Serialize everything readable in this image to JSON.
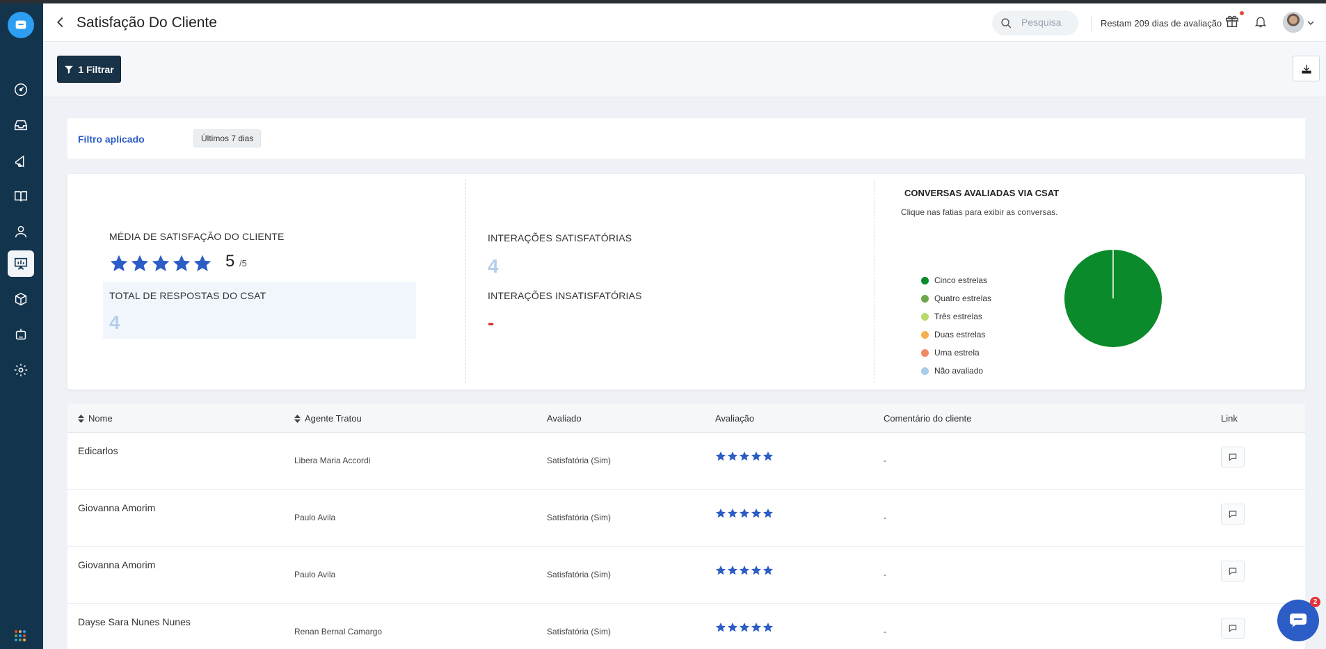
{
  "header": {
    "title": "Satisfação Do Cliente",
    "search_placeholder": "Pesquisa",
    "trial_text": "Restam 209 dias de avaliação"
  },
  "sidebar": {
    "items": [
      {
        "name": "dashboard",
        "icon": "gauge-icon"
      },
      {
        "name": "inbox",
        "icon": "inbox-icon"
      },
      {
        "name": "campaigns",
        "icon": "megaphone-icon"
      },
      {
        "name": "knowledge-base",
        "icon": "book-icon"
      },
      {
        "name": "contacts",
        "icon": "person-icon"
      },
      {
        "name": "reports",
        "icon": "presentation-icon",
        "active": true
      },
      {
        "name": "integrations",
        "icon": "cube-icon"
      },
      {
        "name": "bots",
        "icon": "robot-icon"
      },
      {
        "name": "settings",
        "icon": "gear-icon"
      }
    ]
  },
  "toolbar": {
    "filter_label": "1 Filtrar"
  },
  "filter_applied": {
    "label": "Filtro aplicado",
    "chip": "Últimos 7 dias"
  },
  "stats": {
    "avg_label": "MÉDIA DE SATISFAÇÃO DO CLIENTE",
    "avg_score": "5",
    "avg_max": "/5",
    "avg_stars": 5,
    "total_label": "TOTAL DE RESPOSTAS DO CSAT",
    "total_value": "4",
    "satisfied_label": "INTERAÇÕES SATISFATÓRIAS",
    "satisfied_value": "4",
    "unsatisfied_label": "INTERAÇÕES INSATISFATÓRIAS",
    "unsatisfied_value": "-"
  },
  "chart": {
    "title": "CONVERSAS AVALIADAS VIA CSAT",
    "subtitle": "Clique nas fatias para exibir as conversas."
  },
  "chart_data": {
    "type": "pie",
    "categories": [
      "Cinco estrelas",
      "Quatro estrelas",
      "Três estrelas",
      "Duas estrelas",
      "Uma estrela",
      "Não avaliado"
    ],
    "values": [
      4,
      0,
      0,
      0,
      0,
      0
    ],
    "colors": [
      "#0a8a2a",
      "#6aa84f",
      "#b7d96a",
      "#f4b04f",
      "#ef8a62",
      "#a9cce8"
    ],
    "legend_position": "left"
  },
  "table": {
    "headers": {
      "name": "Nome",
      "agent": "Agente Tratou",
      "rated": "Avaliado",
      "rating": "Avaliação",
      "comment": "Comentário do cliente",
      "link": "Link"
    },
    "rows": [
      {
        "name": "Edicarlos",
        "agent": "Libera Maria Accordi",
        "rated": "Satisfatória (Sim)",
        "stars": 5,
        "comment": "-"
      },
      {
        "name": "Giovanna Amorim",
        "agent": "Paulo Avila",
        "rated": "Satisfatória (Sim)",
        "stars": 5,
        "comment": "-"
      },
      {
        "name": "Giovanna Amorim",
        "agent": "Paulo Avila",
        "rated": "Satisfatória (Sim)",
        "stars": 5,
        "comment": "-"
      },
      {
        "name": "Dayse Sara Nunes Nunes",
        "agent": "Renan Bernal Camargo",
        "rated": "Satisfatória (Sim)",
        "stars": 5,
        "comment": "-"
      }
    ]
  },
  "chat_widget": {
    "badge": "2"
  },
  "colors": {
    "sidebar": "#12344d",
    "accent": "#2c5cc5",
    "star": "#2c5cc5",
    "filter_button": "#183247"
  }
}
